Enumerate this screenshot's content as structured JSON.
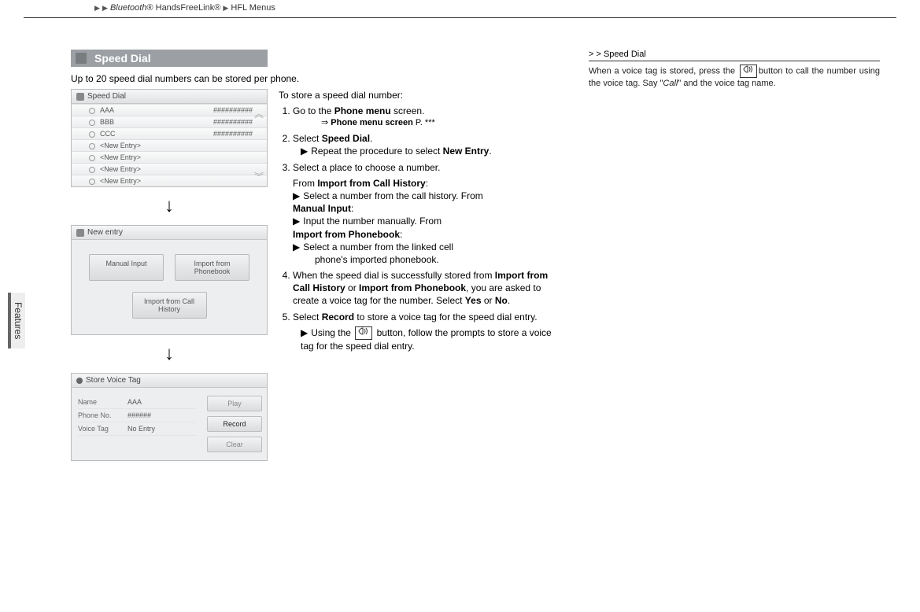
{
  "breadcrumb": {
    "seg1_italic": "Bluetooth",
    "seg1_reg": "®",
    "seg2": "HandsFreeLink®",
    "seg3": "HFL Menus"
  },
  "heading": "Speed Dial",
  "intro": "Up to 20 speed dial numbers can be stored per phone.",
  "features_tab": "Features",
  "shot1": {
    "title": "Speed Dial",
    "rows": [
      {
        "label": "AAA",
        "num": "##########"
      },
      {
        "label": "BBB",
        "num": "##########"
      },
      {
        "label": "CCC",
        "num": "##########"
      },
      {
        "label": "<New Entry>",
        "num": ""
      },
      {
        "label": "<New Entry>",
        "num": ""
      },
      {
        "label": "<New Entry>",
        "num": ""
      },
      {
        "label": "<New Entry>",
        "num": ""
      }
    ]
  },
  "shot2": {
    "title": "New entry",
    "btn_manual": "Manual Input",
    "btn_phonebook": "Import from Phonebook",
    "btn_callhist": "Import from Call History"
  },
  "shot3": {
    "title": "Store Voice Tag",
    "rows": [
      {
        "k": "Name",
        "v": "AAA"
      },
      {
        "k": "Phone No.",
        "v": "######"
      },
      {
        "k": "Voice Tag",
        "v": "No Entry"
      }
    ],
    "btn_play": "Play",
    "btn_record": "Record",
    "btn_clear": "Clear"
  },
  "steps": {
    "lead": "To store a speed dial number:",
    "s1a": "Go to the ",
    "s1b_bold": "Phone menu",
    "s1c": " screen.",
    "s1ref_arrow": "⇒",
    "s1ref_bold": "Phone menu screen",
    "s1ref_tail": " P. ***",
    "s2a": "Select ",
    "s2b_bold": "Speed Dial",
    "s2c": ".",
    "s2sub_a": "Repeat the procedure to select ",
    "s2sub_b_bold": "New Entry",
    "s2sub_c": ".",
    "s3": "Select a place to choose a number.",
    "s3_from": "From ",
    "s3_ich_bold": "Import from Call History",
    "s3_colon": ":",
    "s3_ich_body": "Select a number from the call history. From",
    "s3_mi_bold": "Manual Input",
    "s3_mi_body": "Input the number manually. From",
    "s3_ipb_bold": "Import from Phonebook",
    "s3_ipb_body1": "Select a number from the linked cell",
    "s3_ipb_body2": "phone's imported phonebook.",
    "s4a": "When the speed dial is successfully stored from ",
    "s4b_bold": "Import from Call History",
    "s4c": " or ",
    "s4d_bold": "Import from Phonebook",
    "s4e": ", you are asked to create a voice tag for the number. Select ",
    "s4f_bold": "Yes",
    "s4g": " or ",
    "s4h_bold": "No",
    "s4i": ".",
    "s5a": "Select ",
    "s5b_bold": "Record",
    "s5c": " to store a voice tag for the speed dial entry.",
    "s5sub_a": "Using the ",
    "s5sub_b": " button, follow the prompts to store a voice tag for the speed dial entry.",
    "voice_icon": "⦅❬"
  },
  "side": {
    "hdr_pre": ">  >  ",
    "hdr": "Speed Dial",
    "body_a": "When a voice tag is stored, press the ",
    "body_b": "button to call the number using the voice tag. Say \"",
    "body_c_italic": "Call",
    "body_d": "\"  and the voice tag name."
  }
}
